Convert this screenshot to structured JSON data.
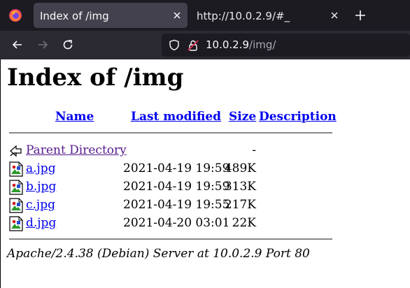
{
  "browser": {
    "tabs": [
      {
        "title": "Index of /img",
        "active": true
      },
      {
        "title": "http://10.0.2.9/#_",
        "active": false
      }
    ],
    "url": {
      "host": "10.0.2.9",
      "path": "/img/"
    }
  },
  "page": {
    "title": "Index of /img",
    "columns": {
      "name": "Name",
      "last_modified": "Last modified",
      "size": "Size",
      "description": "Description"
    },
    "parent": {
      "label": "Parent Directory",
      "size": "-"
    },
    "files": [
      {
        "name": "a.jpg",
        "modified": "2021-04-19 19:59",
        "size": "489K"
      },
      {
        "name": "b.jpg",
        "modified": "2021-04-19 19:59",
        "size": "313K"
      },
      {
        "name": "c.jpg",
        "modified": "2021-04-19 19:55",
        "size": "217K"
      },
      {
        "name": "d.jpg",
        "modified": "2021-04-20 03:01",
        "size": "22K"
      }
    ],
    "address": "Apache/2.4.38 (Debian) Server at 10.0.2.9 Port 80"
  },
  "colors": {
    "link": "#0000ee",
    "visited": "#551a8b",
    "chrome_dark": "#1c1b22",
    "tab_active": "#42414d"
  }
}
